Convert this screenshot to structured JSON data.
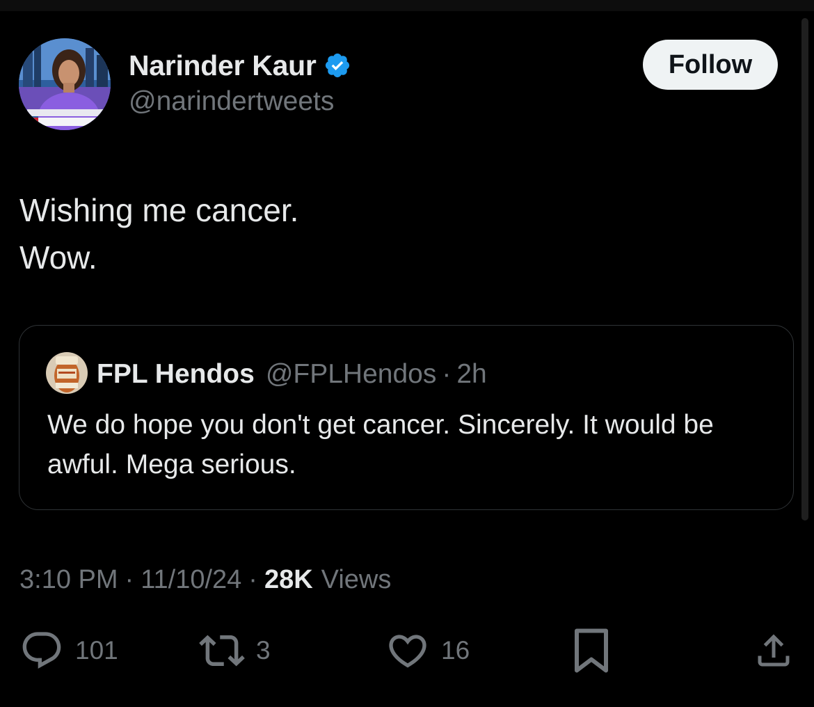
{
  "author": {
    "display_name": "Narinder Kaur",
    "handle": "@narindertweets",
    "verified": true
  },
  "follow_button": {
    "label": "Follow"
  },
  "tweet": {
    "lines": [
      "Wishing me cancer.",
      "Wow."
    ],
    "timestamp": "3:10 PM",
    "date": "11/10/24",
    "separator": "·",
    "views_count": "28K",
    "views_label": "Views"
  },
  "quoted_tweet": {
    "display_name": "FPL Hendos",
    "handle": "@FPLHendos",
    "separator": "·",
    "time": "2h",
    "text": "We do hope you don't get cancer. Sincerely. It would be awful. Mega serious."
  },
  "actions": {
    "replies": "101",
    "reposts": "3",
    "likes": "16"
  },
  "icons": {
    "verified": "verified-badge-icon",
    "reply": "reply-bubble-icon",
    "repost": "repost-arrows-icon",
    "like": "heart-icon",
    "bookmark": "bookmark-icon",
    "share": "share-icon"
  },
  "colors": {
    "background": "#000000",
    "primary_text": "#e7e9ea",
    "secondary_text": "#71767b",
    "verified_blue": "#1d9bf0",
    "border": "#2f3336",
    "follow_bg": "#eff3f4"
  }
}
